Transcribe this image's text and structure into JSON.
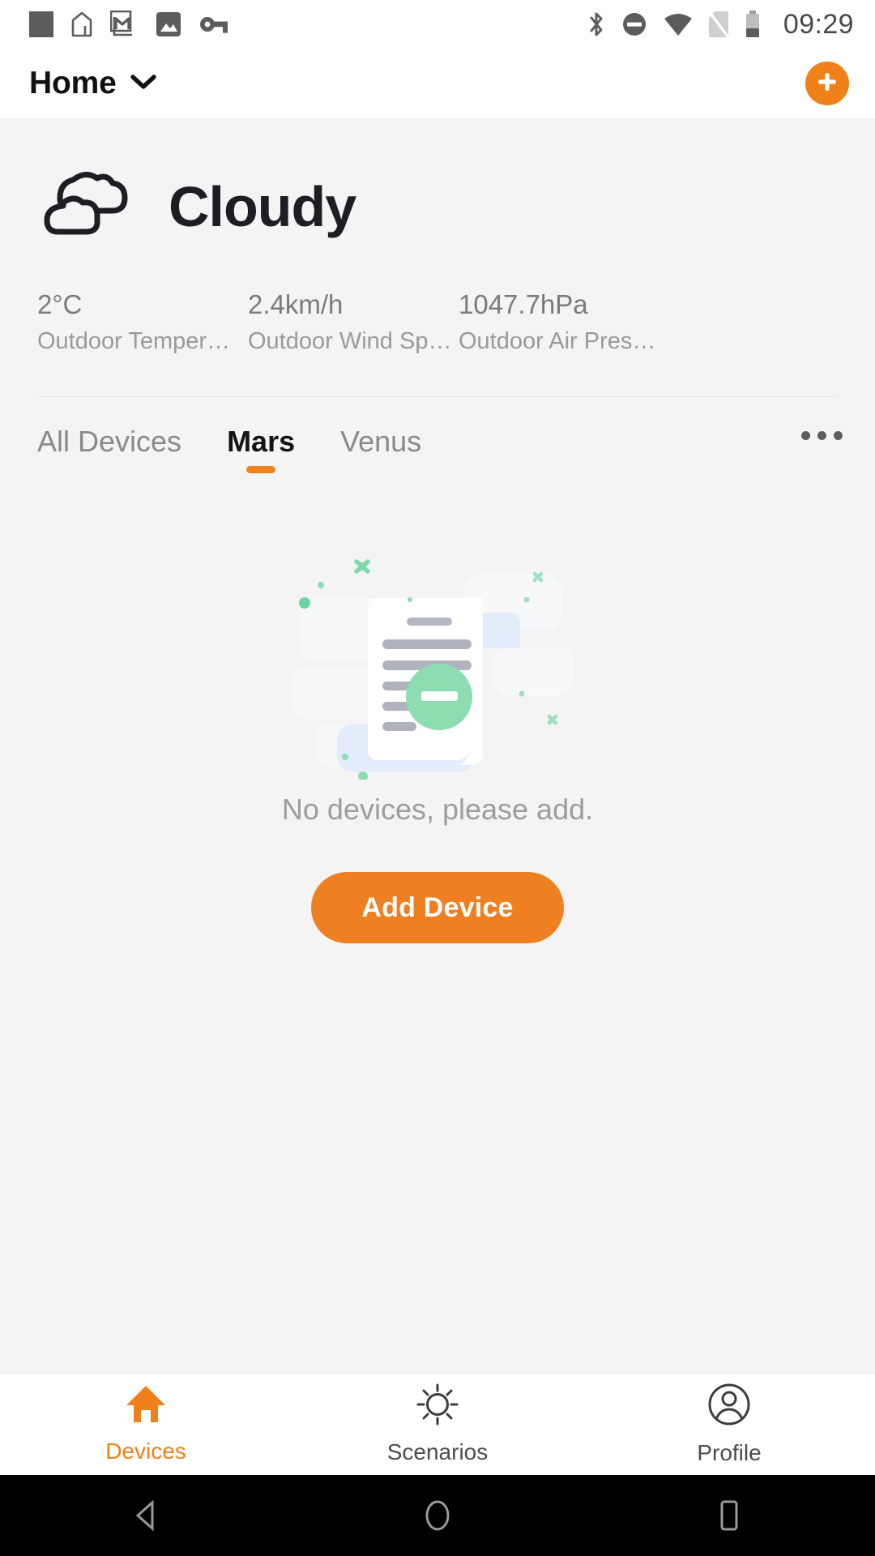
{
  "statusbar": {
    "time": "09:29",
    "left_icons": [
      {
        "name": "app-placeholder-icon"
      },
      {
        "name": "home-outline-icon"
      },
      {
        "name": "gmail-icon"
      },
      {
        "name": "photo-icon"
      },
      {
        "name": "key-icon"
      }
    ],
    "right_icons": [
      {
        "name": "bluetooth-icon"
      },
      {
        "name": "do-not-disturb-icon"
      },
      {
        "name": "wifi-icon"
      },
      {
        "name": "no-sim-icon"
      },
      {
        "name": "battery-icon"
      }
    ]
  },
  "header": {
    "home_label": "Home",
    "dropdown_icon": "chevron-down-icon",
    "add_icon": "plus-icon",
    "accent_color": "#f08019"
  },
  "weather": {
    "condition": "Cloudy",
    "icon": "cloud-icon",
    "stats": [
      {
        "value": "2°C",
        "label": "Outdoor Temper…"
      },
      {
        "value": "2.4km/h",
        "label": "Outdoor Wind Sp…"
      },
      {
        "value": "1047.7hPa",
        "label": "Outdoor Air Pres…"
      }
    ]
  },
  "tabs": {
    "items": [
      {
        "label": "All Devices",
        "active": false
      },
      {
        "label": "Mars",
        "active": true
      },
      {
        "label": "Venus",
        "active": false
      }
    ],
    "more_icon": "more-horizontal-icon"
  },
  "empty_state": {
    "illustration": "no-devices-document-icon",
    "message": "No devices, please add.",
    "button_label": "Add Device",
    "button_color": "#ef8021"
  },
  "bottomnav": {
    "items": [
      {
        "label": "Devices",
        "icon": "home-filled-icon",
        "active": true
      },
      {
        "label": "Scenarios",
        "icon": "sun-icon",
        "active": false
      },
      {
        "label": "Profile",
        "icon": "account-circle-icon",
        "active": false
      }
    ],
    "active_color": "#f08019"
  },
  "androidnav": {
    "items": [
      {
        "name": "back-icon"
      },
      {
        "name": "home-icon"
      },
      {
        "name": "recents-icon"
      }
    ]
  }
}
